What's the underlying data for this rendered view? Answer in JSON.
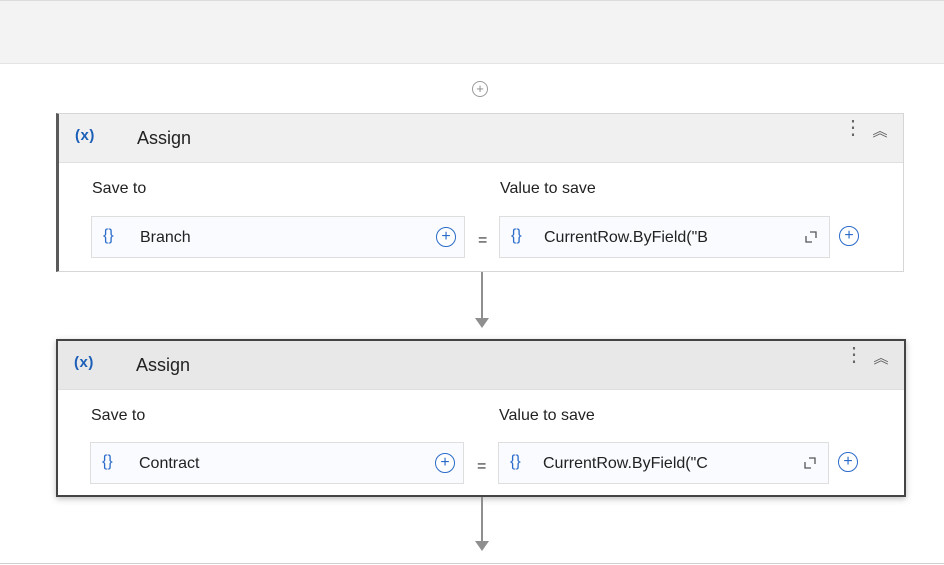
{
  "workflow": {
    "activities": [
      {
        "icon": "variable-icon",
        "icon_text": "(x)",
        "title": "Assign",
        "save_to_label": "Save to",
        "value_label": "Value to save",
        "save_to_value": "Branch",
        "value_expression": "CurrentRow.ByField(\"B",
        "equals": "=",
        "selected": false
      },
      {
        "icon": "variable-icon",
        "icon_text": "(x)",
        "title": "Assign",
        "save_to_label": "Save to",
        "value_label": "Value to save",
        "save_to_value": "Contract",
        "value_expression": "CurrentRow.ByField(\"C",
        "equals": "=",
        "selected": true
      }
    ]
  },
  "icons": {
    "add": "+",
    "brace": "{}",
    "kebab": "⋮",
    "collapse": "︽"
  },
  "colors": {
    "accent": "#2a6bc9",
    "header_bg": "#f0f0f0",
    "selected_border": "#444444",
    "connector": "#8f8f8f"
  }
}
